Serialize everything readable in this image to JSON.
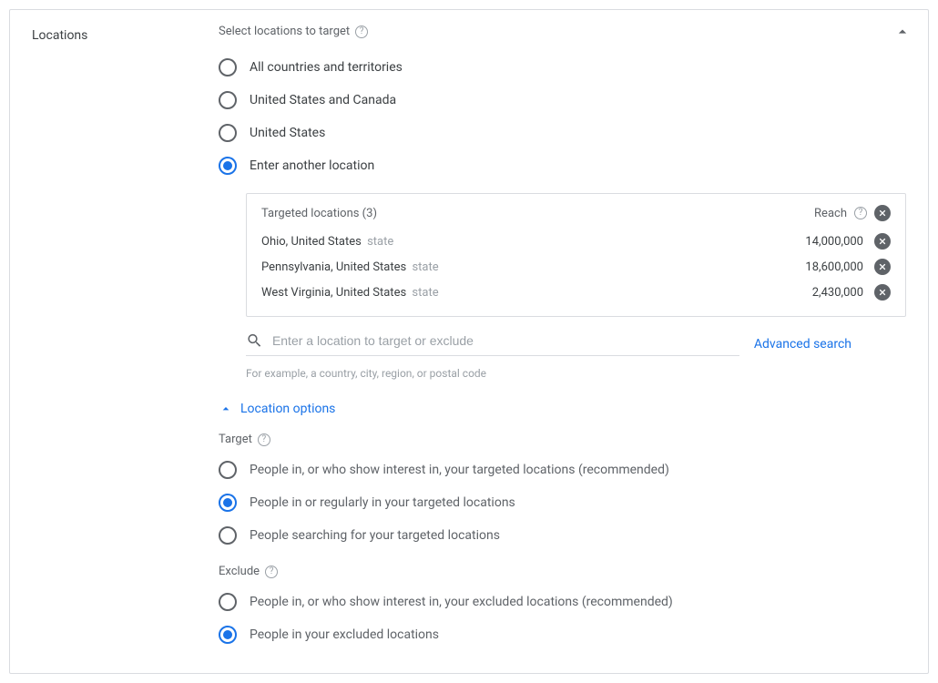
{
  "section_label": "Locations",
  "subtitle": "Select locations to target",
  "mode_options": [
    {
      "label": "All countries and territories",
      "selected": false
    },
    {
      "label": "United States and Canada",
      "selected": false
    },
    {
      "label": "United States",
      "selected": false
    },
    {
      "label": "Enter another location",
      "selected": true
    }
  ],
  "targeted_box": {
    "header_label": "Targeted locations (3)",
    "reach_label": "Reach",
    "rows": [
      {
        "name": "Ohio, United States",
        "type": "state",
        "reach": "14,000,000"
      },
      {
        "name": "Pennsylvania, United States",
        "type": "state",
        "reach": "18,600,000"
      },
      {
        "name": "West Virginia, United States",
        "type": "state",
        "reach": "2,430,000"
      }
    ]
  },
  "search": {
    "placeholder": "Enter a location to target or exclude",
    "advanced_label": "Advanced search",
    "hint": "For example, a country, city, region, or postal code"
  },
  "options_toggle_label": "Location options",
  "target_group": {
    "header": "Target",
    "options": [
      {
        "label": "People in, or who show interest in, your targeted locations (recommended)",
        "selected": false
      },
      {
        "label": "People in or regularly in your targeted locations",
        "selected": true
      },
      {
        "label": "People searching for your targeted locations",
        "selected": false
      }
    ]
  },
  "exclude_group": {
    "header": "Exclude",
    "options": [
      {
        "label": "People in, or who show interest in, your excluded locations (recommended)",
        "selected": false
      },
      {
        "label": "People in your excluded locations",
        "selected": true
      }
    ]
  }
}
